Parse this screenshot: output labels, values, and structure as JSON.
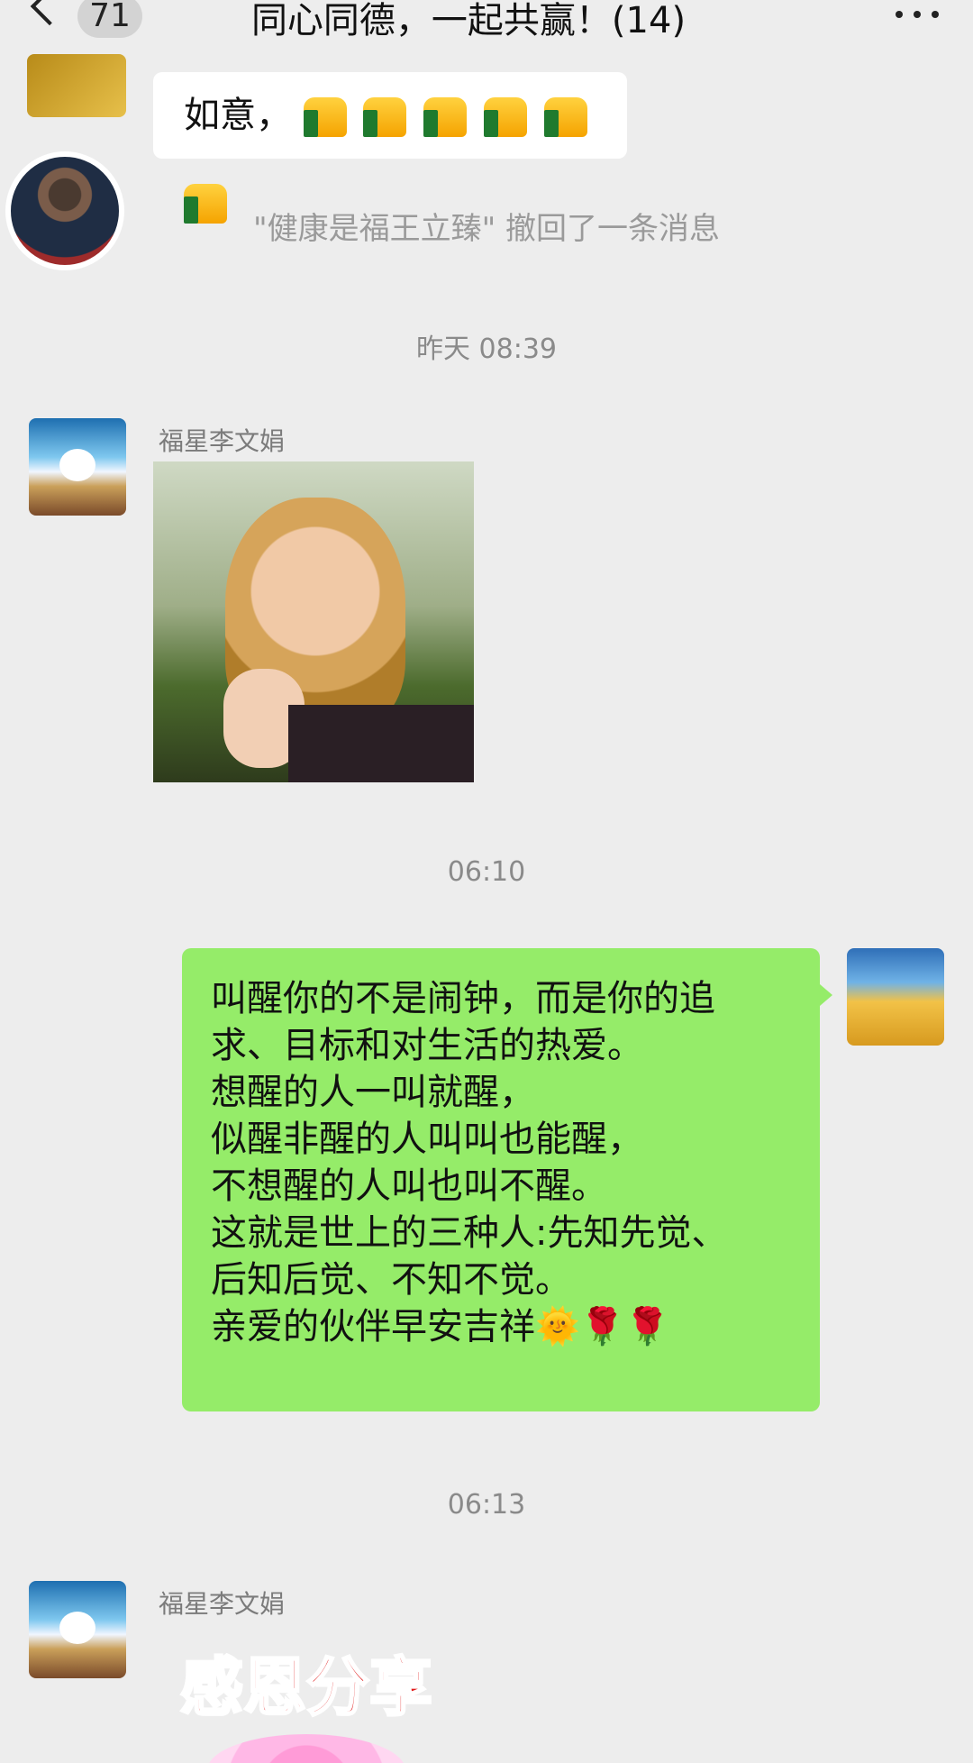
{
  "header": {
    "back_count": "71",
    "title": "同心同德，一起共赢！(14)"
  },
  "messages": {
    "m1_text": "如意，",
    "recall_notice": "\"健康是福王立臻\" 撤回了一条消息",
    "time1": "昨天 08:39",
    "sender1": "福星李文娟",
    "time2": "06:10",
    "self_lines": [
      "叫醒你的不是闹钟，而是你的追",
      "求、目标和对生活的热爱。",
      "想醒的人一叫就醒，",
      "似醒非醒的人叫叫也能醒，",
      "不想醒的人叫也叫不醒。",
      "这就是世上的三种人:先知先觉、",
      "后知后觉、不知不觉。",
      "亲爱的伙伴早安吉祥🌞🌹🌹"
    ],
    "time3": "06:13",
    "sender2": "福星李文娟",
    "image_caption": "感恩分享"
  },
  "colors": {
    "bg": "#ededed",
    "self_bubble": "#95ec69",
    "other_bubble": "#ffffff"
  }
}
